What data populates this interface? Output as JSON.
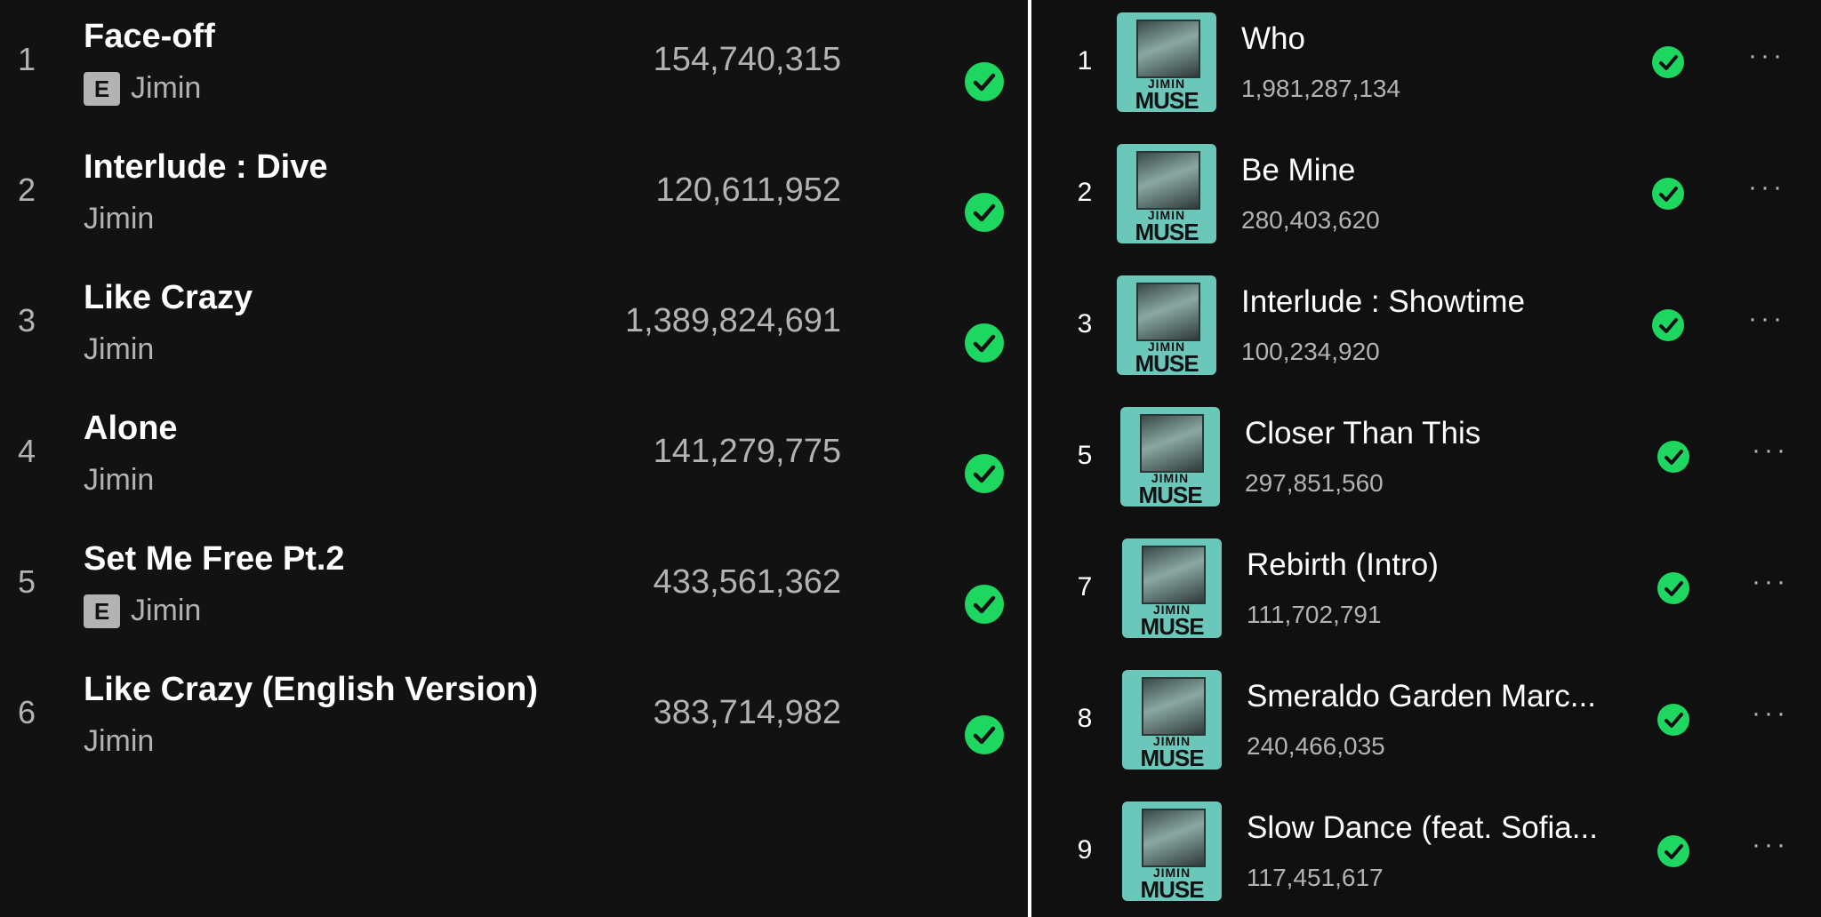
{
  "left_tracks": [
    {
      "num": "1",
      "title": "Face-off",
      "explicit": true,
      "artist": "Jimin",
      "plays": "154,740,315"
    },
    {
      "num": "2",
      "title": "Interlude : Dive",
      "explicit": false,
      "artist": "Jimin",
      "plays": "120,611,952"
    },
    {
      "num": "3",
      "title": "Like Crazy",
      "explicit": false,
      "artist": "Jimin",
      "plays": "1,389,824,691"
    },
    {
      "num": "4",
      "title": "Alone",
      "explicit": false,
      "artist": "Jimin",
      "plays": "141,279,775"
    },
    {
      "num": "5",
      "title": "Set Me Free Pt.2",
      "explicit": true,
      "artist": "Jimin",
      "plays": "433,561,362"
    },
    {
      "num": "6",
      "title": "Like Crazy (English Version)",
      "explicit": false,
      "artist": "Jimin",
      "plays": "383,714,982"
    }
  ],
  "explicit_label": "E",
  "album_art": {
    "tag": "JIMIN",
    "title": "MUSE"
  },
  "more_label": "···",
  "right_tracks": [
    {
      "num": "1",
      "title": "Who",
      "plays": "1,981,287,134"
    },
    {
      "num": "2",
      "title": "Be Mine",
      "plays": "280,403,620"
    },
    {
      "num": "3",
      "title": "Interlude : Showtime",
      "plays": "100,234,920"
    },
    {
      "num": "5",
      "title": "Closer Than This",
      "plays": "297,851,560"
    },
    {
      "num": "7",
      "title": "Rebirth (Intro)",
      "plays": "111,702,791"
    },
    {
      "num": "8",
      "title": "Smeraldo Garden Marc...",
      "plays": "240,466,035"
    },
    {
      "num": "9",
      "title": "Slow Dance (feat. Sofia...",
      "plays": "117,451,617"
    }
  ],
  "colors": {
    "check": "#1ed760",
    "background": "#121212",
    "subtext": "#b3b3b3",
    "album_teal": "#6cc7bb"
  },
  "icons": {
    "saved": "check-circle-icon",
    "more": "more-options-icon"
  }
}
